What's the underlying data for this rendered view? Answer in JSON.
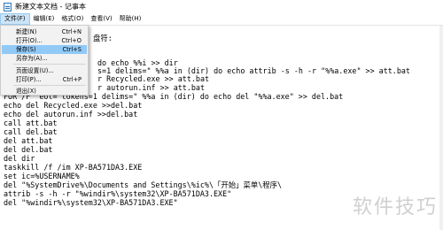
{
  "window": {
    "title": "新建文本文档 - 记事本",
    "icon": "notepad-icon"
  },
  "menubar": {
    "items": [
      "文件(F)",
      "编辑(E)",
      "格式(O)",
      "查看(V)",
      "帮助(H)"
    ]
  },
  "file_menu": {
    "items": [
      {
        "label": "新建(N)",
        "shortcut": "Ctrl+N"
      },
      {
        "label": "打开(O)...",
        "shortcut": "Ctrl+O"
      },
      {
        "label": "保存(S)",
        "shortcut": "Ctrl+S"
      },
      {
        "label": "另存为(A)...",
        "shortcut": ""
      },
      {
        "label": "页面设置(U)...",
        "shortcut": ""
      },
      {
        "label": "打印(P)...",
        "shortcut": "Ctrl+P"
      },
      {
        "label": "退出(X)",
        "shortcut": ""
      }
    ],
    "highlighted_index": 2
  },
  "editor": {
    "lines": [
      "盘符:",
      "do echo %%i >> dir",
      "s=1 delims=\" %%a in (dir) do echo attrib -s -h -r \"%%a.exe\" >> att.bat",
      "r Recycled.exe >> att.bat",
      "r autorun.inf >> att.bat",
      "FOR /F \"eol= tokens=1 delims=\" %%a in (dir) do echo del \"%%a.exe\" >> del.bat",
      "echo del Recycled.exe >>del.bat",
      "echo del autorun.inf >>del.bat",
      "call att.bat",
      "call del.bat",
      "del att.bat",
      "del del.bat",
      "del dir",
      "taskkill /f /im XP-BA571DA3.EXE",
      "set ic=%USERNAME%",
      "del \"%SystemDrive%\\Documents and Settings\\%ic%\\「开始」菜单\\程序\\",
      "attrib -s -h -r \"%windir%\\system32\\XP-BA571DA3.EXE\"",
      "del \"%windir%\\system32\\XP-BA571DA3.EXE\""
    ]
  },
  "watermark": "软件技巧"
}
